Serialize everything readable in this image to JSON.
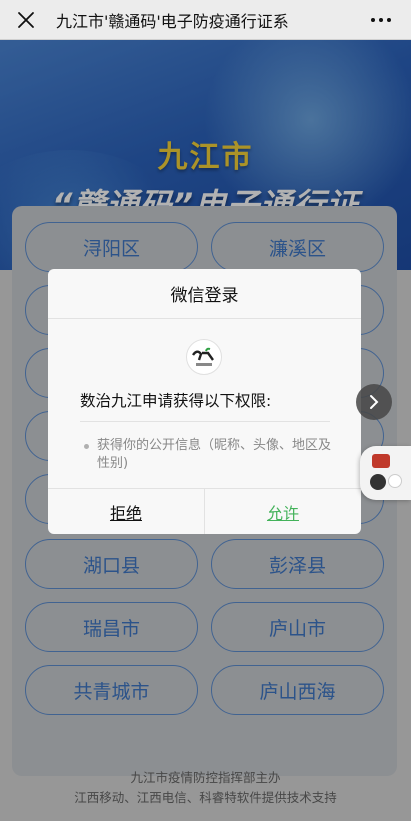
{
  "nav": {
    "title": "九江市'赣通码'电子防疫通行证系",
    "close_icon": "close-icon",
    "more_icon": "more-dots-icon"
  },
  "banner": {
    "city": "九江市",
    "title": "“赣通码”电子通行证"
  },
  "districts": [
    {
      "label": "浔阳区"
    },
    {
      "label": "濂溪区"
    },
    {
      "label": ""
    },
    {
      "label": ""
    },
    {
      "label": ""
    },
    {
      "label": ""
    },
    {
      "label": ""
    },
    {
      "label": ""
    },
    {
      "label": ""
    },
    {
      "label": ""
    },
    {
      "label": "湖口县"
    },
    {
      "label": "彭泽县"
    },
    {
      "label": "瑞昌市"
    },
    {
      "label": "庐山市"
    },
    {
      "label": "共青城市"
    },
    {
      "label": "庐山西海"
    }
  ],
  "footer": {
    "line1": "九江市疫情防控指挥部主办",
    "line2": "江西移动、江西电信、科睿特软件提供技术支持"
  },
  "dialog": {
    "title": "微信登录",
    "heading": "数治九江申请获得以下权限:",
    "permission": "获得你的公开信息（昵称、头像、地区及性别)",
    "reject": "拒绝",
    "allow": "允许"
  },
  "colors": {
    "accent_blue": "#3f78c6",
    "allow_green": "#43b25a",
    "banner_yellow": "#f5d33a"
  }
}
